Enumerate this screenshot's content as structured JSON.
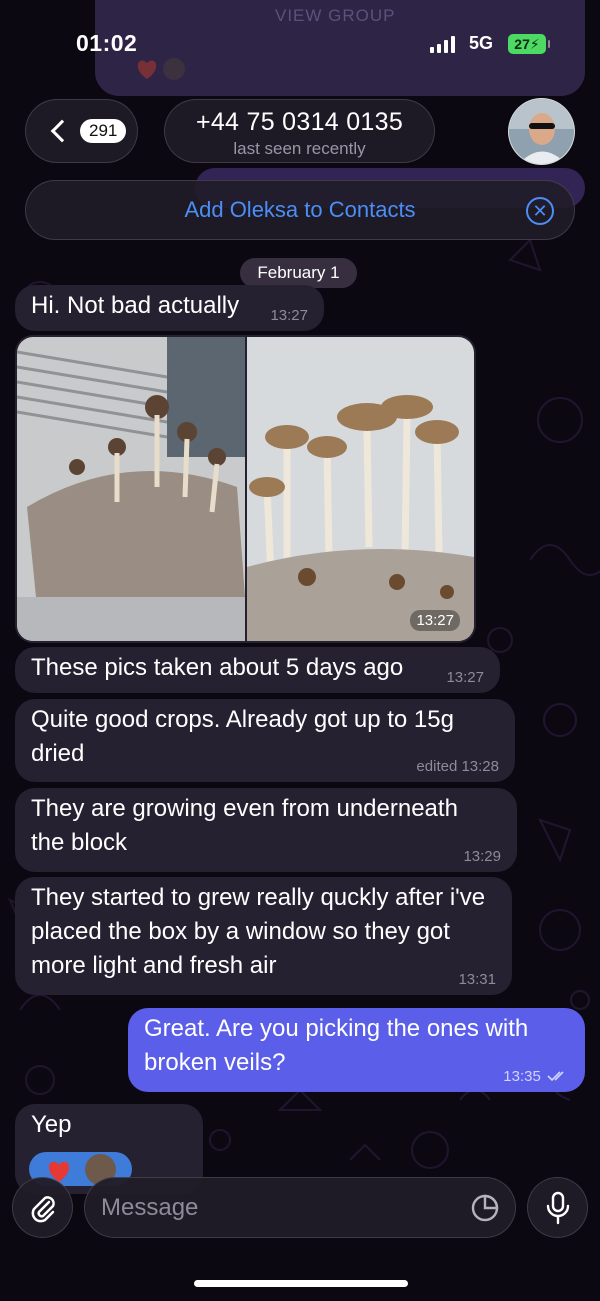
{
  "status": {
    "time": "01:02",
    "network": "5G",
    "battery": "27"
  },
  "background": {
    "view_group_label": "VIEW GROUP"
  },
  "header": {
    "unread_count": "291",
    "title": "+44 75 0314 0135",
    "subtitle": "last seen recently",
    "icons": [
      "chevron-left-icon",
      "avatar"
    ]
  },
  "contacts_banner": {
    "label": "Add Oleksa to Contacts",
    "close_icon": "close-circle-icon",
    "accent": "#4c8df6"
  },
  "date_chip": "February 1",
  "messages": [
    {
      "text": "Hi. Not bad actually",
      "time": "13:27"
    },
    {
      "type": "photo",
      "time": "13:27"
    },
    {
      "text": "These pics taken about 5 days ago",
      "time": "13:27"
    },
    {
      "text": "Quite good crops. Already got up to 15g dried",
      "time": "edited 13:28"
    },
    {
      "text": "They are growing even from underneath the block",
      "time": "13:29"
    },
    {
      "text": "They started to grew really quckly after i've placed the box by a window so they got more light and fresh air",
      "time": "13:31"
    },
    {
      "text": "Great. Are you picking the ones with broken veils?",
      "time": "13:35",
      "sent": true,
      "status_icon": "double-check-icon"
    },
    {
      "text": "Yep",
      "reactions": [
        "heart-icon",
        "avatar"
      ]
    }
  ],
  "composer": {
    "placeholder": "Message",
    "attach_icon": "paperclip-icon",
    "sticker_icon": "sticker-icon",
    "mic_icon": "microphone-icon"
  },
  "colors": {
    "sent_bubble": "#5b5ee8",
    "received_bubble": "#262131",
    "accent_blue": "#4c8df6",
    "battery": "#4cd964"
  }
}
